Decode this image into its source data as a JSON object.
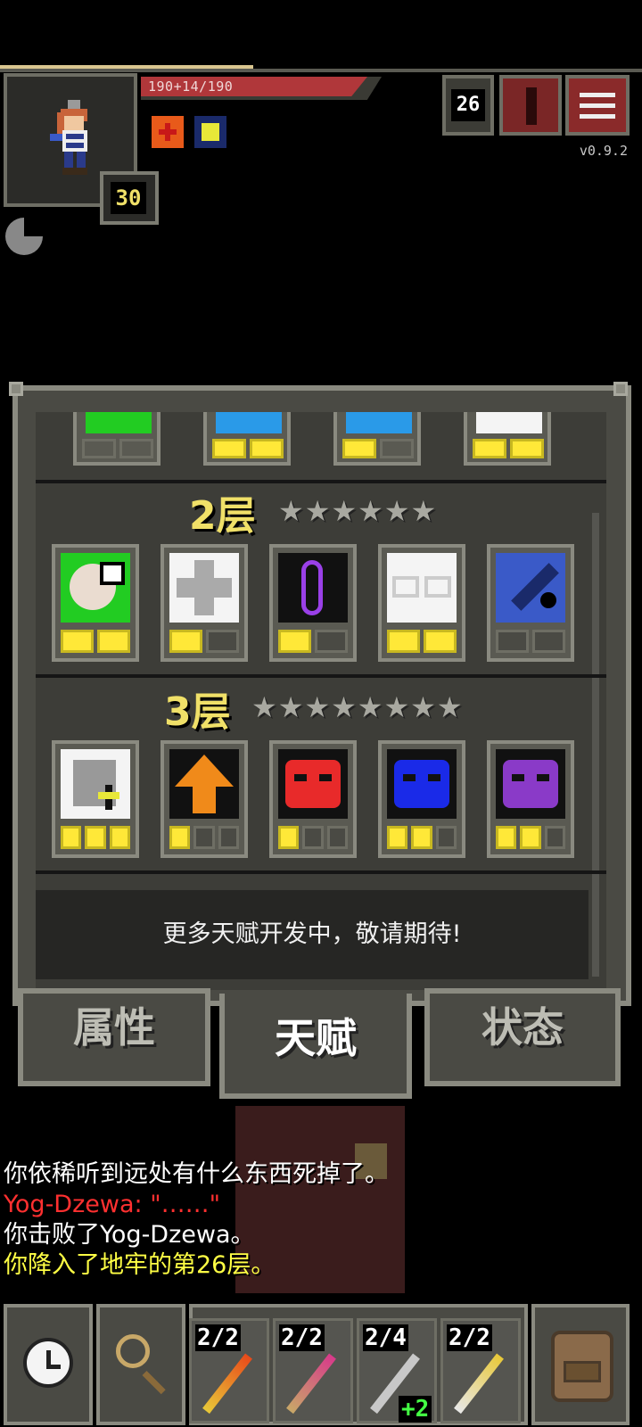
{
  "hud": {
    "hp_text": "190+14/190",
    "hero_level": "30",
    "depth": "26",
    "version": "v0.9.2"
  },
  "talents": {
    "tier2": {
      "label": "2层",
      "stars": "★★★★★★"
    },
    "tier3": {
      "label": "3层",
      "stars": "★★★★★★★★"
    },
    "coming_soon": "更多天赋开发中，敬请期待!"
  },
  "tabs": {
    "stats": "属性",
    "talents": "天赋",
    "status": "状态"
  },
  "log": {
    "line1": "你依稀听到远处有什么东西死掉了。",
    "line2": "Yog-Dzewa: \"……\"",
    "line3": "你击败了Yog-Dzewa。",
    "line4": "你降入了地牢的第26层。"
  },
  "quickslots": {
    "slot1_count": "2/2",
    "slot2_count": "2/2",
    "slot3_count": "2/4",
    "slot3_bonus": "+2",
    "slot4_count": "2/2"
  },
  "colors": {
    "log_white": "#ffffff",
    "log_red": "#ff3030",
    "log_yellow": "#ffff44",
    "tier_gold": "#f0e068"
  }
}
